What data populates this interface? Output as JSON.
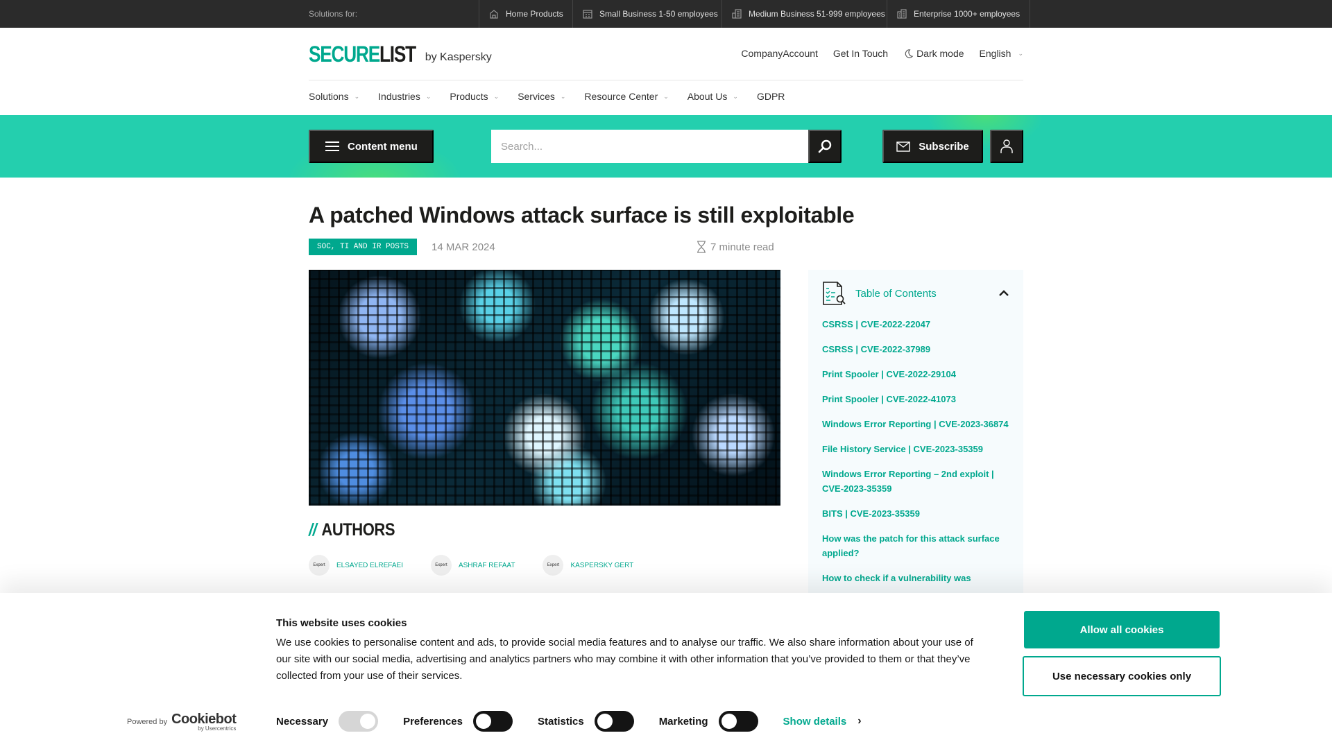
{
  "topbar": {
    "label": "Solutions for:",
    "segments": [
      {
        "icon": "home-icon",
        "label": "Home Products"
      },
      {
        "icon": "small-business-icon",
        "label": "Small Business 1-50 employees"
      },
      {
        "icon": "medium-business-icon",
        "label": "Medium Business 51-999 employees"
      },
      {
        "icon": "enterprise-icon",
        "label": "Enterprise 1000+ employees"
      }
    ]
  },
  "header": {
    "logo_primary": "SECURE",
    "logo_secondary": "LIST",
    "logo_by": "by Kaspersky",
    "links": {
      "company_account": "CompanyAccount",
      "get_in_touch": "Get In Touch",
      "dark_mode": "Dark mode",
      "language": "English"
    }
  },
  "nav": {
    "items": [
      {
        "label": "Solutions",
        "has_dropdown": true
      },
      {
        "label": "Industries",
        "has_dropdown": true
      },
      {
        "label": "Products",
        "has_dropdown": true
      },
      {
        "label": "Services",
        "has_dropdown": true
      },
      {
        "label": "Resource Center",
        "has_dropdown": true
      },
      {
        "label": "About Us",
        "has_dropdown": true
      },
      {
        "label": "GDPR",
        "has_dropdown": false
      }
    ]
  },
  "toolbar": {
    "content_menu": "Content menu",
    "search_placeholder": "Search...",
    "subscribe": "Subscribe"
  },
  "article": {
    "title": "A patched Windows attack surface is still exploitable",
    "tag": "SOC, TI AND IR POSTS",
    "date": "14 MAR 2024",
    "read_time": "7 minute read",
    "authors_heading": "AUTHORS",
    "authors_prefix": "//",
    "authors": [
      {
        "badge": "Expert",
        "name": "ELSAYED ELREFAEI"
      },
      {
        "badge": "Expert",
        "name": "ASHRAF REFAAT"
      },
      {
        "badge": "Expert",
        "name": "KASPERSKY GERT"
      }
    ]
  },
  "toc": {
    "title": "Table of Contents",
    "items": [
      "CSRSS | CVE-2022-22047",
      "CSRSS | CVE-2022-37989",
      "Print Spooler | CVE-2022-29104",
      "Print Spooler | CVE-2022-41073",
      "Windows Error Reporting | CVE-2023-36874",
      "File History Service | CVE-2023-35359",
      "Windows Error Reporting – 2nd exploit | CVE-2023-35359",
      "BITS | CVE-2023-35359",
      "How was the patch for this attack surface applied?",
      "How to check if a vulnerability was"
    ]
  },
  "cookie": {
    "title": "This website uses cookies",
    "text": "We use cookies to personalise content and ads, to provide social media features and to analyse our traffic. We also share information about your use of our site with our social media, advertising and analytics partners who may combine it with other information that you’ve provided to them or that they’ve collected from your use of their services.",
    "powered_by": "Powered by",
    "brand": "Cookiebot",
    "brand_sub": "by Usercentrics",
    "toggles": [
      {
        "label": "Necessary",
        "state": "on-disabled"
      },
      {
        "label": "Preferences",
        "state": "off"
      },
      {
        "label": "Statistics",
        "state": "off"
      },
      {
        "label": "Marketing",
        "state": "off"
      }
    ],
    "show_details": "Show details",
    "allow_all": "Allow all cookies",
    "necessary_only": "Use necessary cookies only"
  },
  "colors": {
    "accent": "#00a88e",
    "band": "#24cfae",
    "dark": "#1d1d1b",
    "topbar": "#2b2b2b"
  }
}
